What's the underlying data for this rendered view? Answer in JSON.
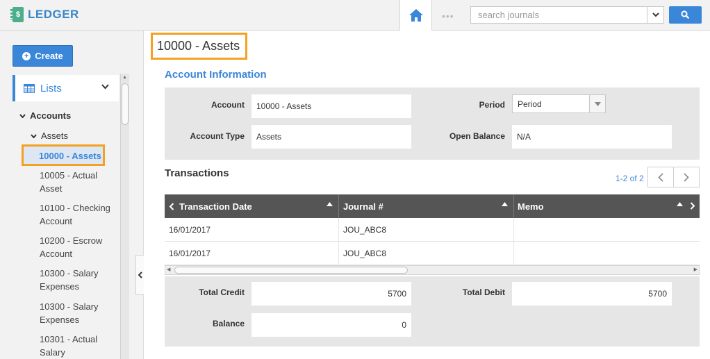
{
  "header": {
    "brand": "LEDGER",
    "search_placeholder": "search journals",
    "dots": "•••"
  },
  "sidebar": {
    "create_label": "Create",
    "lists_label": "Lists",
    "tree": {
      "accounts": "Accounts",
      "assets": "Assets",
      "active": "10000 - Assets",
      "items": [
        "10005 - Actual Asset",
        "10100 - Checking Account",
        "10200 - Escrow Account",
        "10300 - Salary Expenses",
        "10300 - Salary Expenses",
        "10301 - Actual Salary"
      ]
    }
  },
  "main": {
    "title": "10000 - Assets",
    "section_title": "Account Information",
    "fields": {
      "account_label": "Account",
      "account_value": "10000 - Assets",
      "period_label": "Period",
      "period_value": "Period",
      "type_label": "Account Type",
      "type_value": "Assets",
      "open_balance_label": "Open Balance",
      "open_balance_value": "N/A"
    },
    "transactions": {
      "title": "Transactions",
      "pager": "1-2 of 2",
      "columns": [
        "Transaction Date",
        "Journal #",
        "Memo"
      ],
      "rows": [
        [
          "16/01/2017",
          "JOU_ABC8",
          ""
        ],
        [
          "16/01/2017",
          "JOU_ABC8",
          ""
        ]
      ]
    },
    "totals": {
      "credit_label": "Total Credit",
      "credit_value": "5700",
      "debit_label": "Total Debit",
      "debit_value": "5700",
      "balance_label": "Balance",
      "balance_value": "0"
    }
  },
  "colors": {
    "accent": "#3a86d8",
    "highlight": "#f5a020",
    "brand_icon": "#4cae8d",
    "table_header": "#555555"
  }
}
